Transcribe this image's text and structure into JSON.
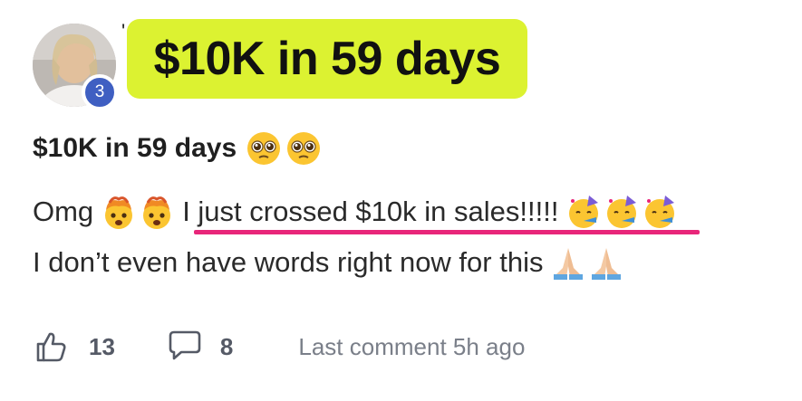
{
  "author": {
    "name_fragment": "'",
    "level": "3"
  },
  "banner": {
    "text": "$10K in 59 days"
  },
  "post": {
    "title": "$10K in 59 days",
    "title_emojis": [
      "pleading-face",
      "pleading-face"
    ],
    "line1_prefix": "Omg",
    "line1_emojis": [
      "exploding-head",
      "exploding-head"
    ],
    "line1_highlight": "I just crossed $10k in sales!!!!!",
    "line1_trailing_emojis": [
      "partying-face",
      "partying-face",
      "partying-face"
    ],
    "line2_text": "I don’t even have words right now for this",
    "line2_emojis": [
      "folded-hands",
      "folded-hands"
    ]
  },
  "footer": {
    "likes": "13",
    "comments": "8",
    "last_comment": "Last comment 5h ago"
  },
  "colors": {
    "banner_bg": "#dcf231",
    "underline": "#e8267a",
    "badge": "#3f5fc2"
  }
}
